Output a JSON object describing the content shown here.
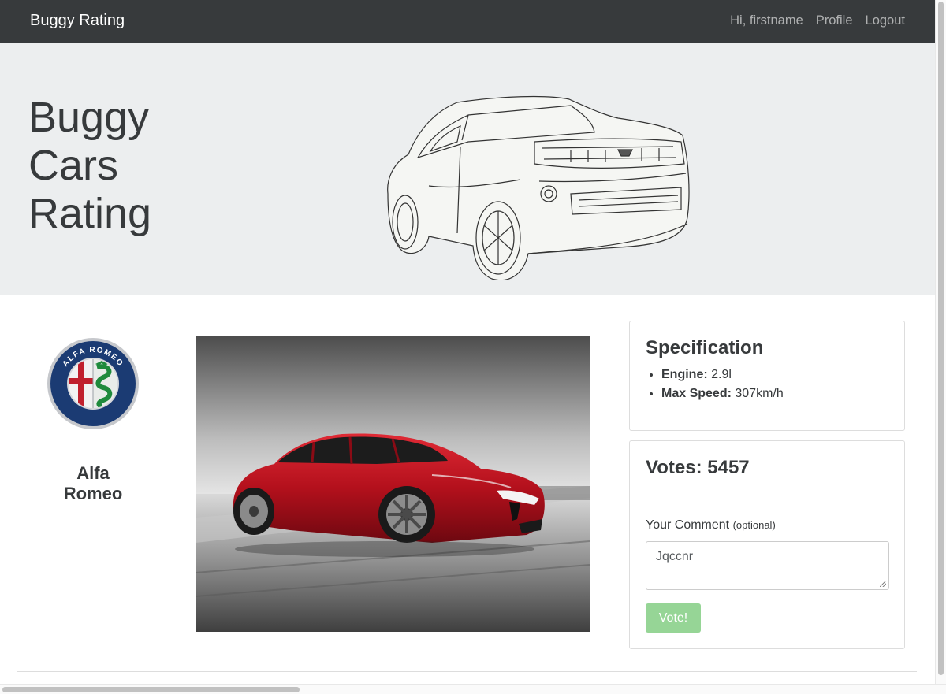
{
  "navbar": {
    "brand": "Buggy Rating",
    "greeting": "Hi, firstname",
    "profile": "Profile",
    "logout": "Logout"
  },
  "hero": {
    "title_lines": [
      "Buggy",
      "Cars",
      "Rating"
    ]
  },
  "make": {
    "name_line1": "Alfa",
    "name_line2": "Romeo",
    "logo_text": "ALFA ROMEO"
  },
  "specification": {
    "title": "Specification",
    "engine_label": "Engine:",
    "engine_value": "2.9l",
    "speed_label": "Max Speed:",
    "speed_value": "307km/h"
  },
  "voting": {
    "votes_label": "Votes:",
    "votes_count": "5457",
    "comment_label": "Your Comment",
    "comment_optional": "(optional)",
    "comment_value": "Jqccnr",
    "vote_button": "Vote!"
  },
  "colors": {
    "navbar_bg": "#373a3c",
    "jumbotron_bg": "#eceeef",
    "vote_button_bg": "#96d596",
    "car_red": "#b3101c"
  }
}
